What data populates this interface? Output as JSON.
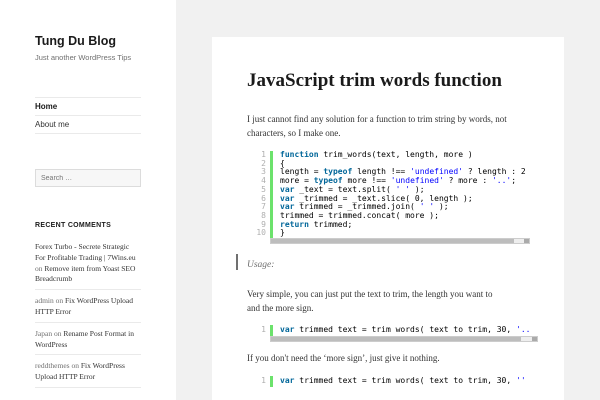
{
  "site": {
    "title": "Tung Du Blog",
    "description": "Just another WordPress Tips"
  },
  "nav": {
    "items": [
      {
        "label": "Home",
        "current": true
      },
      {
        "label": "About me",
        "current": false
      }
    ]
  },
  "search": {
    "placeholder": "Search …"
  },
  "recent_comments": {
    "title": "RECENT COMMENTS",
    "items": [
      {
        "author": "Forex Turbo - Secrete Strategic For Profitable Trading | 7Wins.eu",
        "on": "on",
        "post": "Remove item from Yoast SEO Breadcrumb"
      },
      {
        "author": "admin",
        "on": "on",
        "post": "Fix WordPress Upload HTTP Error"
      },
      {
        "author": "Japan",
        "on": "on",
        "post": "Rename Post Format in WordPress"
      },
      {
        "author": "reddthemes",
        "on": "on",
        "post": "Fix WordPress Upload HTTP Error"
      }
    ]
  },
  "post": {
    "title": "JavaScript trim words function",
    "intro_line1": "I just cannot find any solution for a function to trim string by words, not",
    "intro_line2": "characters, so I make one.",
    "usage_label": "Usage:",
    "usage_line1": "Very simple, you can just put the text to trim, the length you want to",
    "usage_line2": "and the more sign.",
    "nomore_text": "If you don't need the ‘more sign’, just give it nothing."
  },
  "code_main": {
    "line_numbers": [
      "1",
      "2",
      "3",
      "4",
      "5",
      "6",
      "7",
      "8",
      "9",
      "10"
    ]
  },
  "code_usage": {
    "line_number": "1",
    "text": "var trimmed text = trim words( text to trim, 30, '.."
  },
  "code_nomore": {
    "line_number": "1",
    "text": "var trimmed text = trim words( text to trim, 30, ''"
  },
  "colors": {
    "code_keyword": "#006699",
    "code_string": "#0000ff",
    "gutter_border": "#6ce26c"
  }
}
